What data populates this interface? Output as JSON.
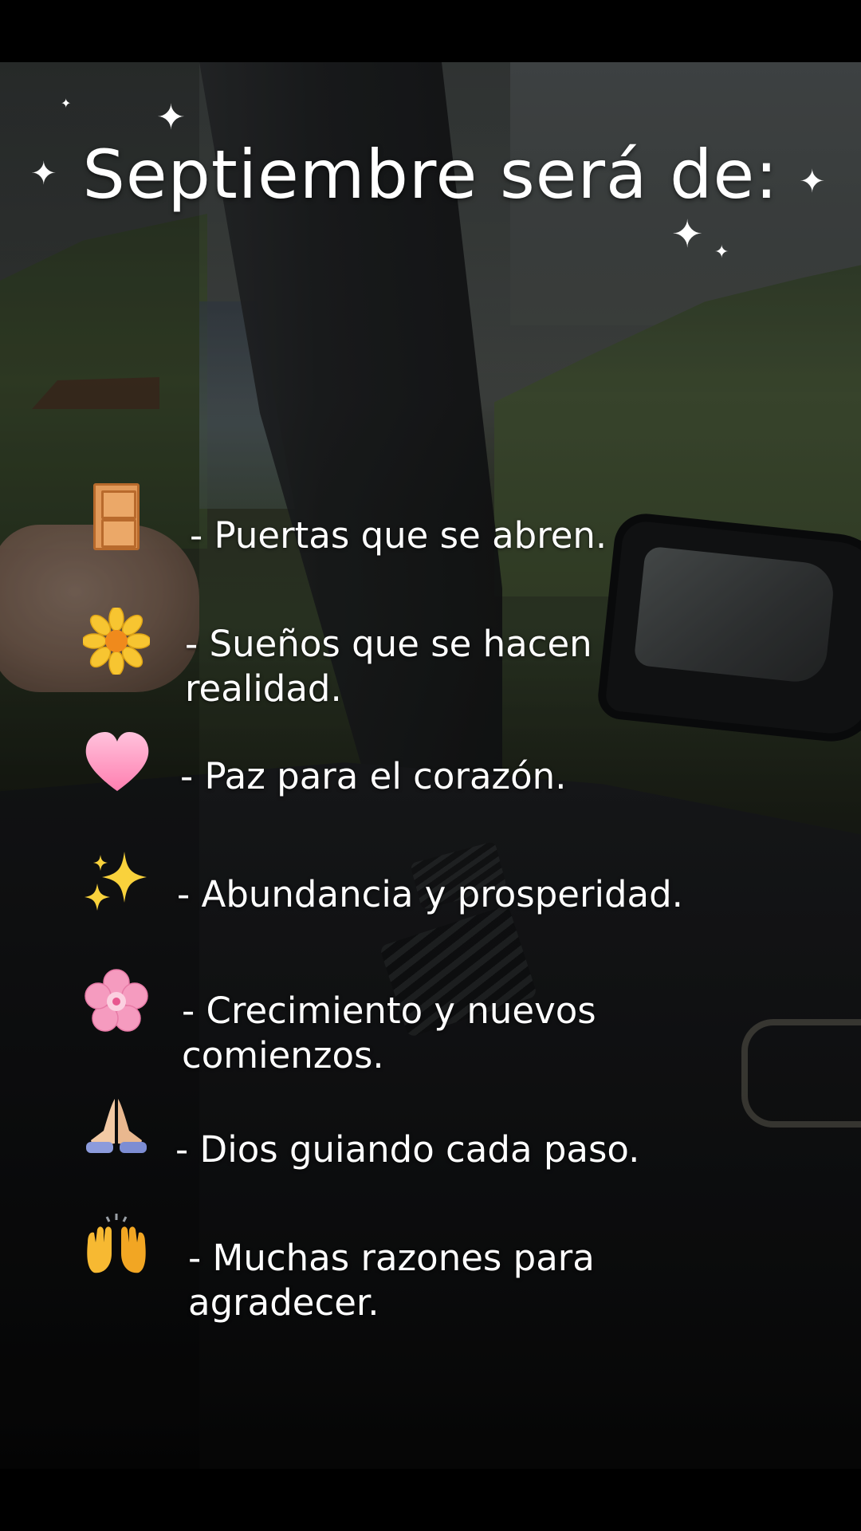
{
  "title": "Septiembre será de:",
  "items": [
    {
      "icon": "door-icon",
      "text": "- Puertas que se abren."
    },
    {
      "icon": "sunflower-icon",
      "text": "- Sueños que se hacen realidad."
    },
    {
      "icon": "pink-heart-icon",
      "text": "- Paz para el corazón."
    },
    {
      "icon": "sparkles-icon",
      "text": "- Abundancia y prosperidad."
    },
    {
      "icon": "cherry-blossom-icon",
      "text": "- Crecimiento y nuevos comienzos."
    },
    {
      "icon": "folded-hands-icon",
      "text": "- Dios guiando cada paso."
    },
    {
      "icon": "raising-hands-icon",
      "text": "- Muchas razones para agradecer."
    }
  ],
  "colors": {
    "background": "#000000",
    "text": "#ffffff",
    "door": "#e29a5a",
    "sunflower": "#f7c531",
    "heart": "#ff9cc4",
    "sparkle": "#f9d23c",
    "blossom": "#f59bbf"
  }
}
